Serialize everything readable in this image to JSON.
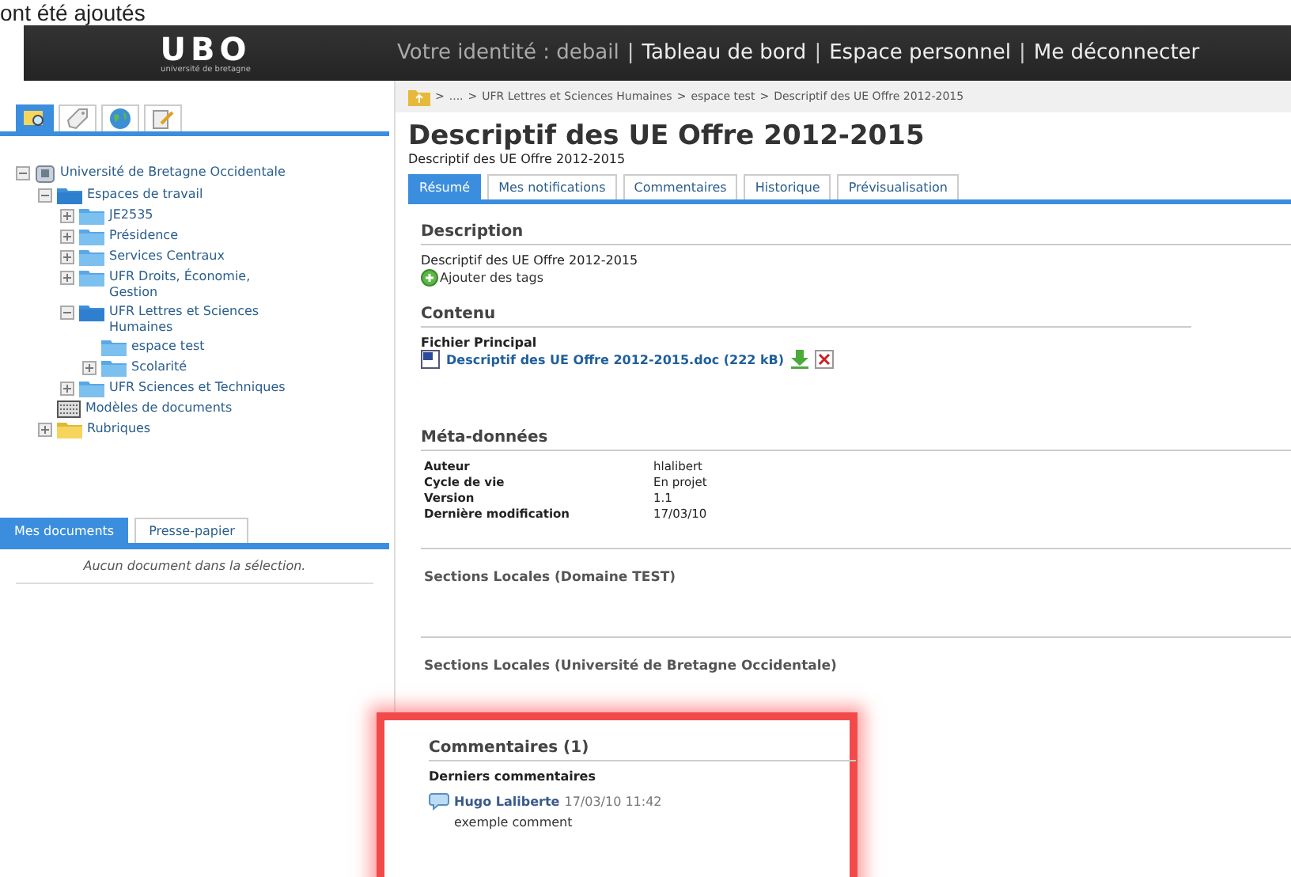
{
  "caption": "ont été ajoutés",
  "header": {
    "logo": "UBO",
    "logo_subtitle": "université de bretagne",
    "identity_label": "Votre identité : debail",
    "separator": "|",
    "links": [
      "Tableau de bord",
      "Espace personnel",
      "Me déconnecter"
    ]
  },
  "sidebar": {
    "icon_tabs": [
      {
        "kind": "search",
        "selected": true
      },
      {
        "kind": "tag",
        "selected": false
      },
      {
        "kind": "globe",
        "selected": false
      },
      {
        "kind": "edit",
        "selected": false
      }
    ],
    "tree": [
      {
        "label": "Université de Bretagne Occidentale",
        "kind": "root",
        "expanded": true,
        "children": [
          {
            "label": "Espaces de travail",
            "kind": "folder",
            "expanded": true,
            "children": [
              {
                "label": "JE2535",
                "kind": "folder",
                "expanded": false
              },
              {
                "label": "Présidence",
                "kind": "folder",
                "expanded": false
              },
              {
                "label": "Services Centraux",
                "kind": "folder",
                "expanded": false
              },
              {
                "label": "UFR Droits, Économie, Gestion",
                "kind": "folder",
                "expanded": false
              },
              {
                "label": "UFR Lettres et Sciences Humaines",
                "kind": "folder",
                "expanded": true,
                "children": [
                  {
                    "label": "espace test",
                    "kind": "folder"
                  },
                  {
                    "label": "Scolarité",
                    "kind": "folder",
                    "expanded": false
                  }
                ]
              },
              {
                "label": "UFR Sciences et Techniques",
                "kind": "folder",
                "expanded": false
              }
            ]
          },
          {
            "label": "Modèles de documents",
            "kind": "template"
          },
          {
            "label": "Rubriques",
            "kind": "rubric",
            "expanded": false
          }
        ]
      }
    ],
    "doc_tabs": [
      {
        "label": "Mes documents",
        "selected": true
      },
      {
        "label": "Presse-papier",
        "selected": false
      }
    ],
    "empty_message": "Aucun document dans la sélection."
  },
  "breadcrumb_separator": ">",
  "breadcrumb": [
    "....",
    "UFR Lettres et Sciences Humaines",
    "espace test",
    "Descriptif des UE Offre 2012-2015"
  ],
  "title": "Descriptif des UE Offre 2012-2015",
  "subtitle": "Descriptif des UE Offre 2012-2015",
  "tabs": [
    {
      "label": "Résumé",
      "selected": true
    },
    {
      "label": "Mes notifications",
      "selected": false
    },
    {
      "label": "Commentaires",
      "selected": false
    },
    {
      "label": "Historique",
      "selected": false
    },
    {
      "label": "Prévisualisation",
      "selected": false
    }
  ],
  "description": {
    "heading": "Description",
    "text": "Descriptif des UE Offre 2012-2015",
    "add_tags": "Ajouter des tags"
  },
  "content": {
    "heading": "Contenu",
    "file_label": "Fichier Principal",
    "file_link": "Descriptif des UE Offre 2012-2015.doc (222 kB)"
  },
  "metadata": {
    "heading": "Méta-données",
    "rows": [
      {
        "key": "Auteur",
        "value": "hlalibert"
      },
      {
        "key": "Cycle de vie",
        "value": "En projet"
      },
      {
        "key": "Version",
        "value": "1.1"
      },
      {
        "key": "Dernière modification",
        "value": "17/03/10"
      }
    ]
  },
  "sections": [
    "Sections Locales (Domaine TEST)",
    "Sections Locales (Université de Bretagne Occidentale)"
  ],
  "comments": {
    "heading": "Commentaires (1)",
    "subheading": "Derniers commentaires",
    "items": [
      {
        "author": "Hugo Laliberte",
        "date": "17/03/10 11:42",
        "text": "exemple comment"
      }
    ]
  }
}
